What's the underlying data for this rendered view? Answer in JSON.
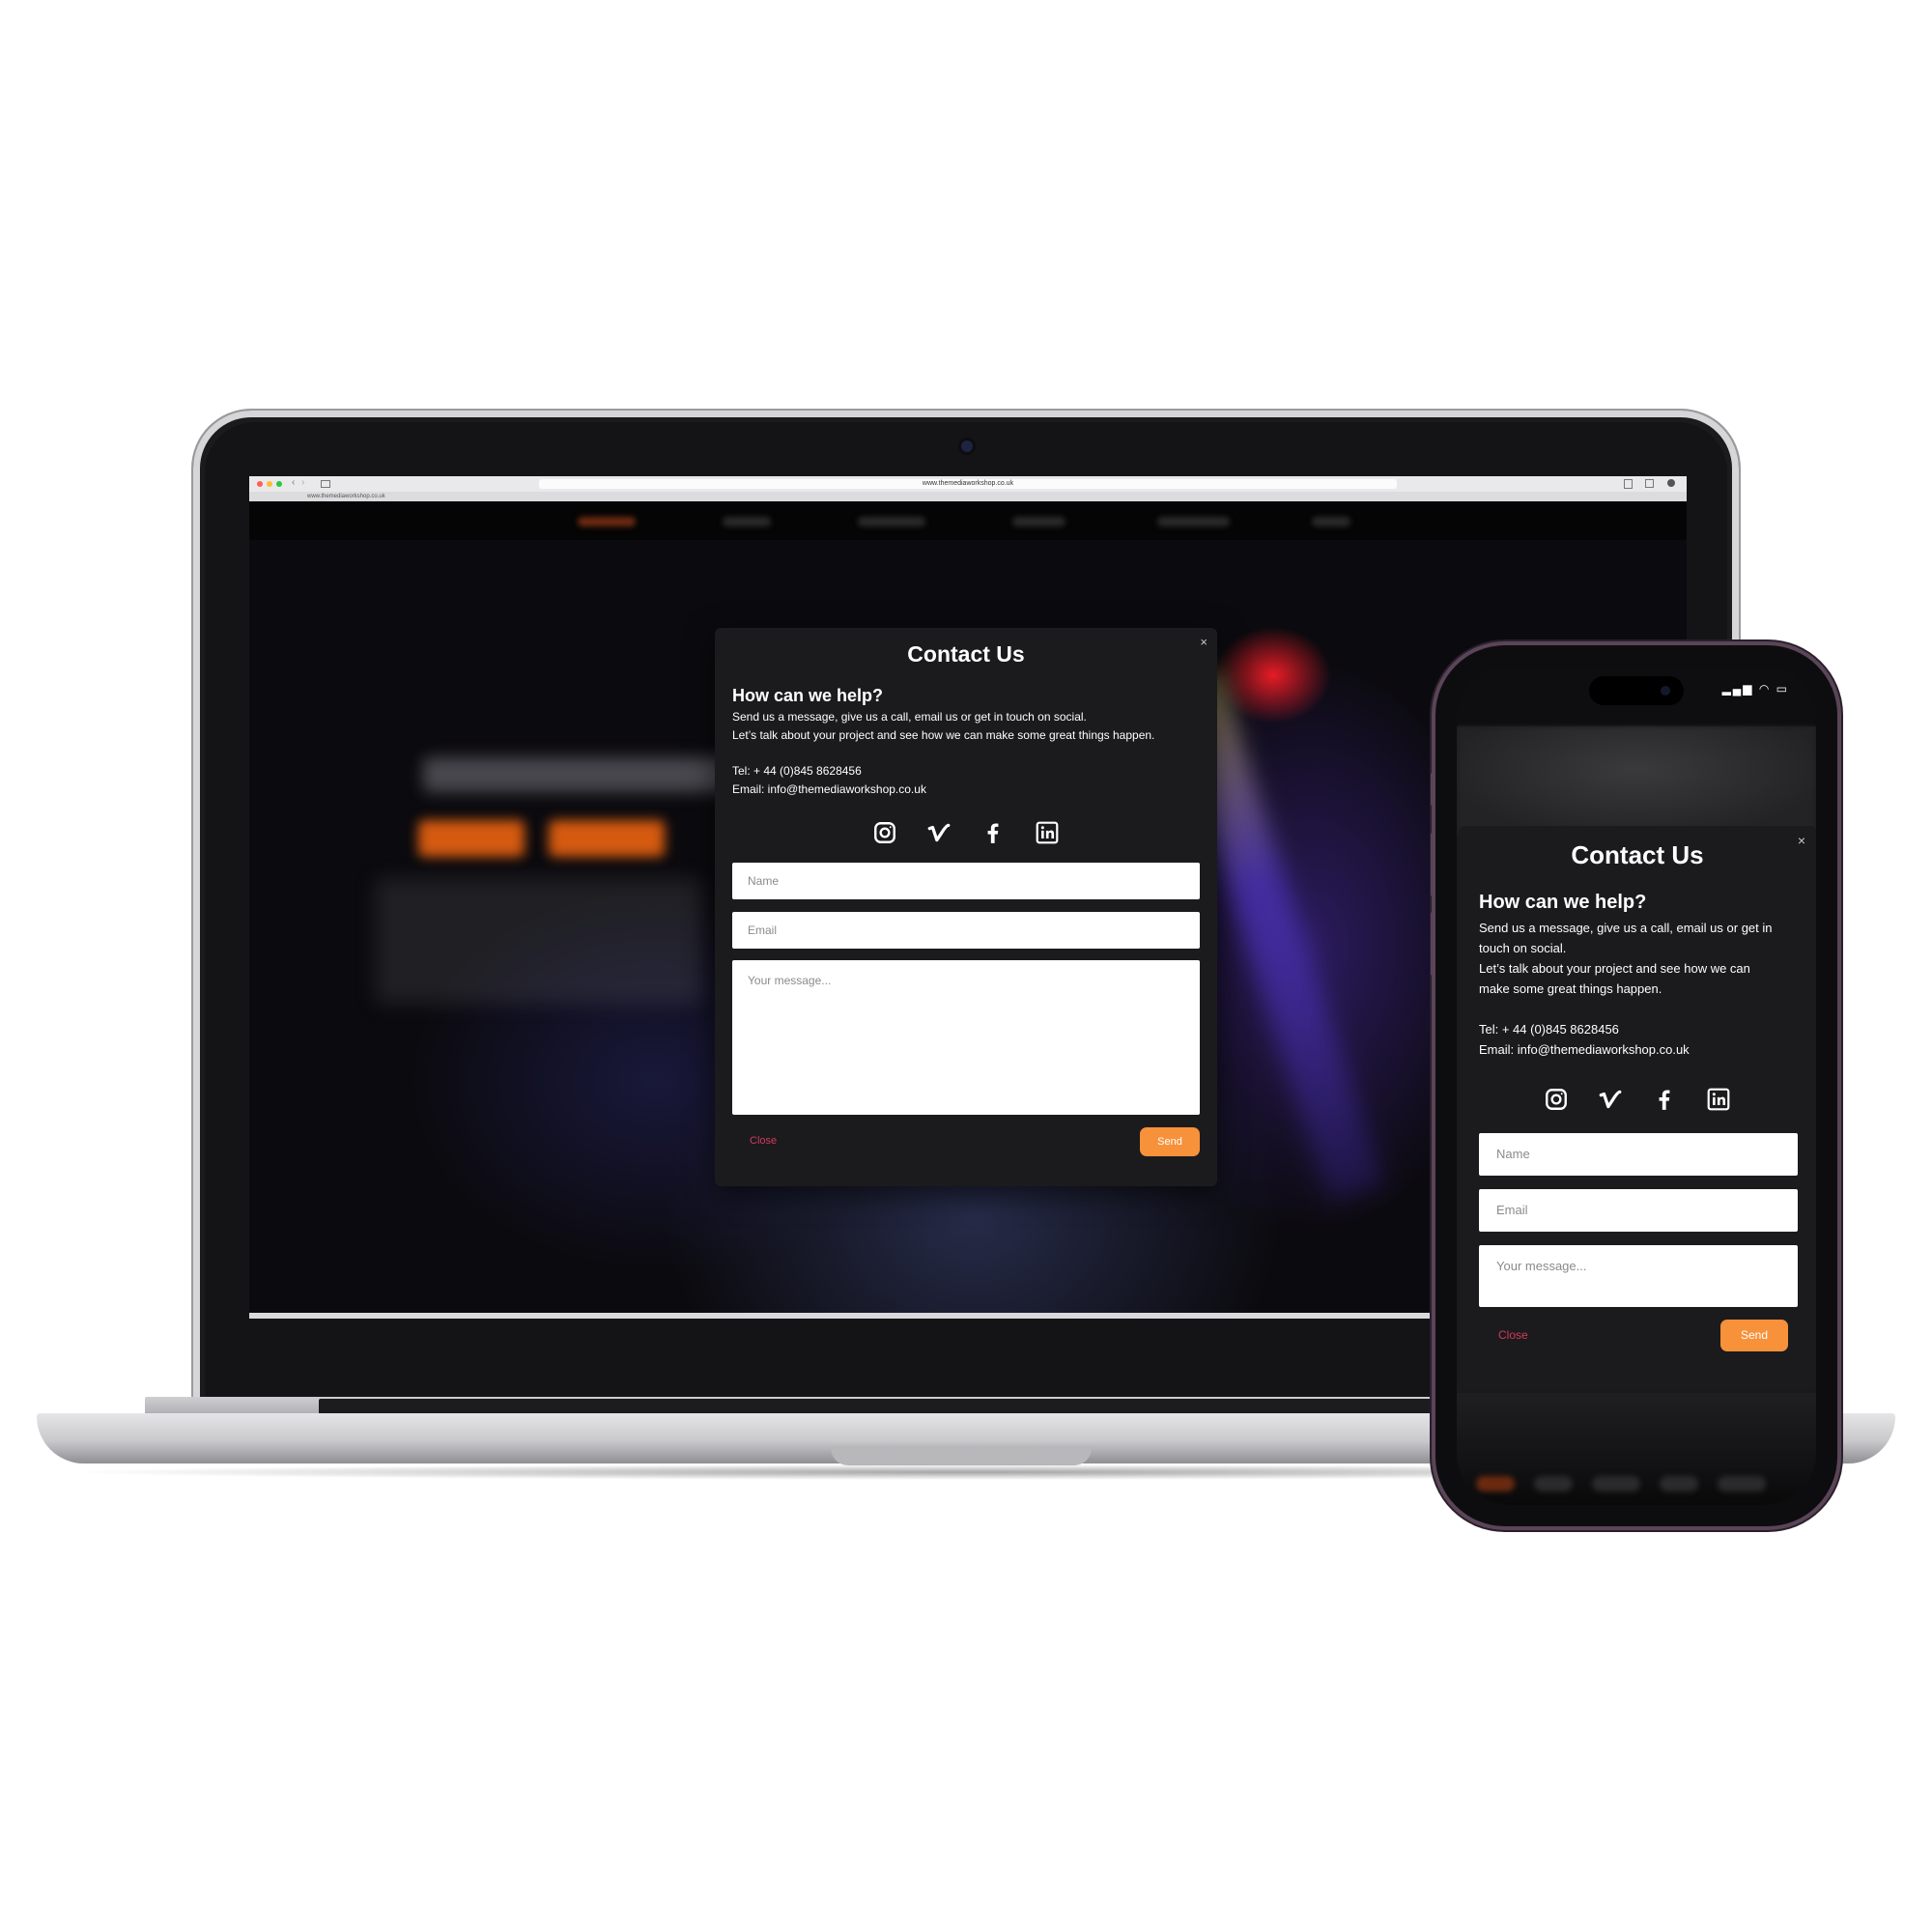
{
  "browser": {
    "url": "www.themediaworkshop.co.uk",
    "tab_title": "www.themediaworkshop.co.uk"
  },
  "desktop_modal": {
    "title": "Contact Us",
    "close_symbol": "×",
    "heading": "How can we help?",
    "intro_line1": "Send us a message, give us a call, email us or get in touch on social.",
    "intro_line2": "Let’s talk about your project and see how we can make some great things happen.",
    "tel": "Tel: + 44 (0)845 8628456",
    "email": "Email: info@themediaworkshop.co.uk",
    "socials": [
      "instagram-icon",
      "vimeo-icon",
      "facebook-icon",
      "linkedin-icon"
    ],
    "name_placeholder": "Name",
    "email_placeholder": "Email",
    "message_placeholder": "Your message...",
    "close_label": "Close",
    "send_label": "Send"
  },
  "mobile_modal": {
    "title": "Contact Us",
    "close_symbol": "×",
    "heading": "How can we help?",
    "intro_line1": "Send us a message, give us a call, email us or get in touch on social.",
    "intro_line2": "Let’s talk about your project and see how we can make some great things happen.",
    "tel": "Tel: + 44 (0)845 8628456",
    "email": "Email: info@themediaworkshop.co.uk",
    "name_placeholder": "Name",
    "email_placeholder": "Email",
    "message_placeholder": "Your message...",
    "close_label": "Close",
    "send_label": "Send"
  },
  "colors": {
    "modal_bg": "#1b1b1d",
    "send_button": "#f7913a",
    "close_link": "#d23a5c",
    "phone_frame": "#5a4558"
  }
}
